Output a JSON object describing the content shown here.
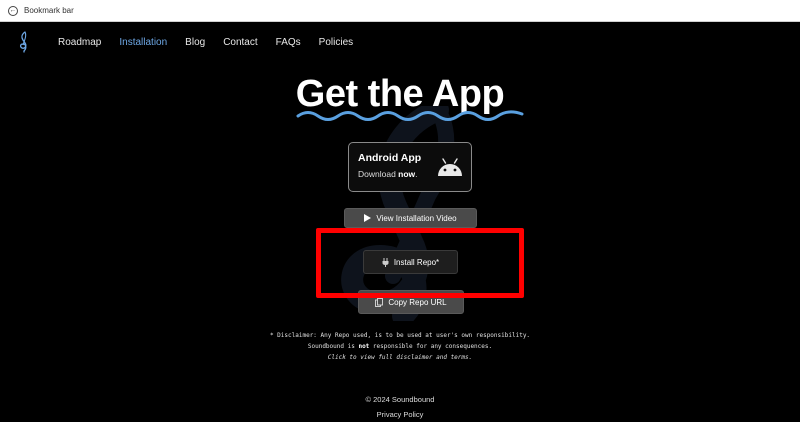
{
  "bookmark_bar": {
    "label": "Bookmark bar"
  },
  "nav": {
    "items": [
      {
        "label": "Roadmap",
        "active": false
      },
      {
        "label": "Installation",
        "active": true
      },
      {
        "label": "Blog",
        "active": false
      },
      {
        "label": "Contact",
        "active": false
      },
      {
        "label": "FAQs",
        "active": false
      },
      {
        "label": "Policies",
        "active": false
      }
    ]
  },
  "hero": {
    "title": "Get the App"
  },
  "android_card": {
    "title": "Android App",
    "sub_prefix": "Download ",
    "sub_bold": "now",
    "sub_suffix": ".",
    "icon": "android-icon"
  },
  "buttons": {
    "video": {
      "label": "View Installation Video",
      "icon": "play-icon"
    },
    "repo": {
      "label": "Install Repo*",
      "icon": "plug-icon"
    },
    "copy": {
      "label": "Copy Repo URL",
      "icon": "copy-icon"
    }
  },
  "disclaimer": {
    "line1": "* Disclaimer: Any Repo used, is to be used at user's own responsibility.",
    "line2_prefix": "Soundbound is ",
    "line2_bold": "not",
    "line2_suffix": " responsible for any consequences.",
    "line3": "Click to view full disclaimer and terms."
  },
  "footer": {
    "copyright": "© 2024 Soundbound",
    "privacy": "Privacy Policy"
  },
  "colors": {
    "accent": "#6ea8e6",
    "wave": "#5aa0e0",
    "highlight": "#ff0000",
    "background": "#000000"
  }
}
